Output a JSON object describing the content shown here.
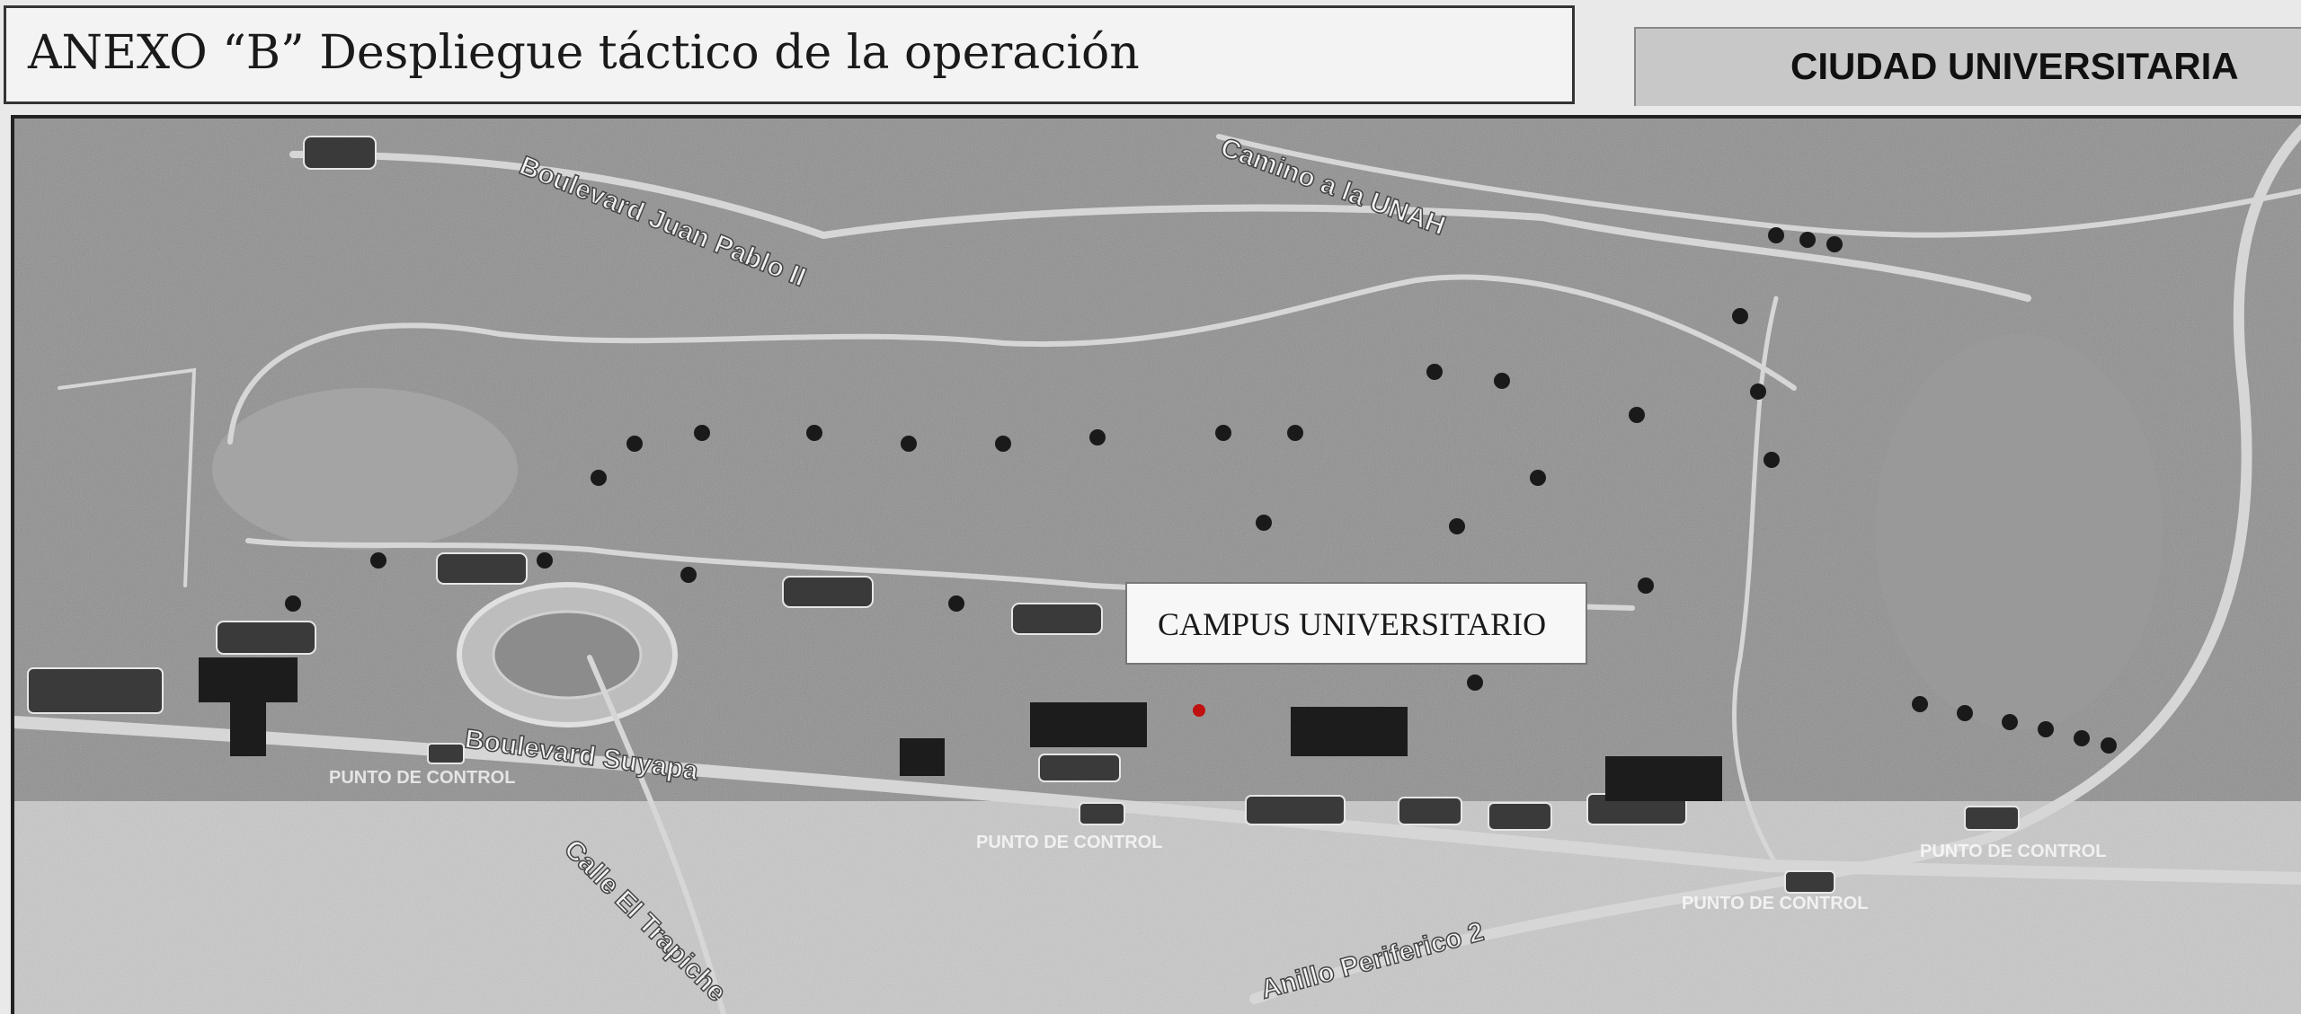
{
  "header": {
    "title": "ANEXO “B” Despliegue táctico de la operación",
    "location": "CIUDAD UNIVERSITARIA"
  },
  "map": {
    "campus_label": "CAMPUS UNIVERSITARIO",
    "streets": {
      "juan_pablo": "Boulevard Juan Pablo II",
      "camino_unah": "Camino a la UNAH",
      "suyapa": "Boulevard Suyapa",
      "el_trapiche": "Calle El Trapiche",
      "anillo": "Anillo Periferico 2"
    },
    "checkpoint_label": "PUNTO DE CONTROL",
    "colors": {
      "background": "#9a9a9a",
      "roads": "#d9d9d9",
      "street_text": "#f2f2f2",
      "marker": "#c01010"
    }
  }
}
